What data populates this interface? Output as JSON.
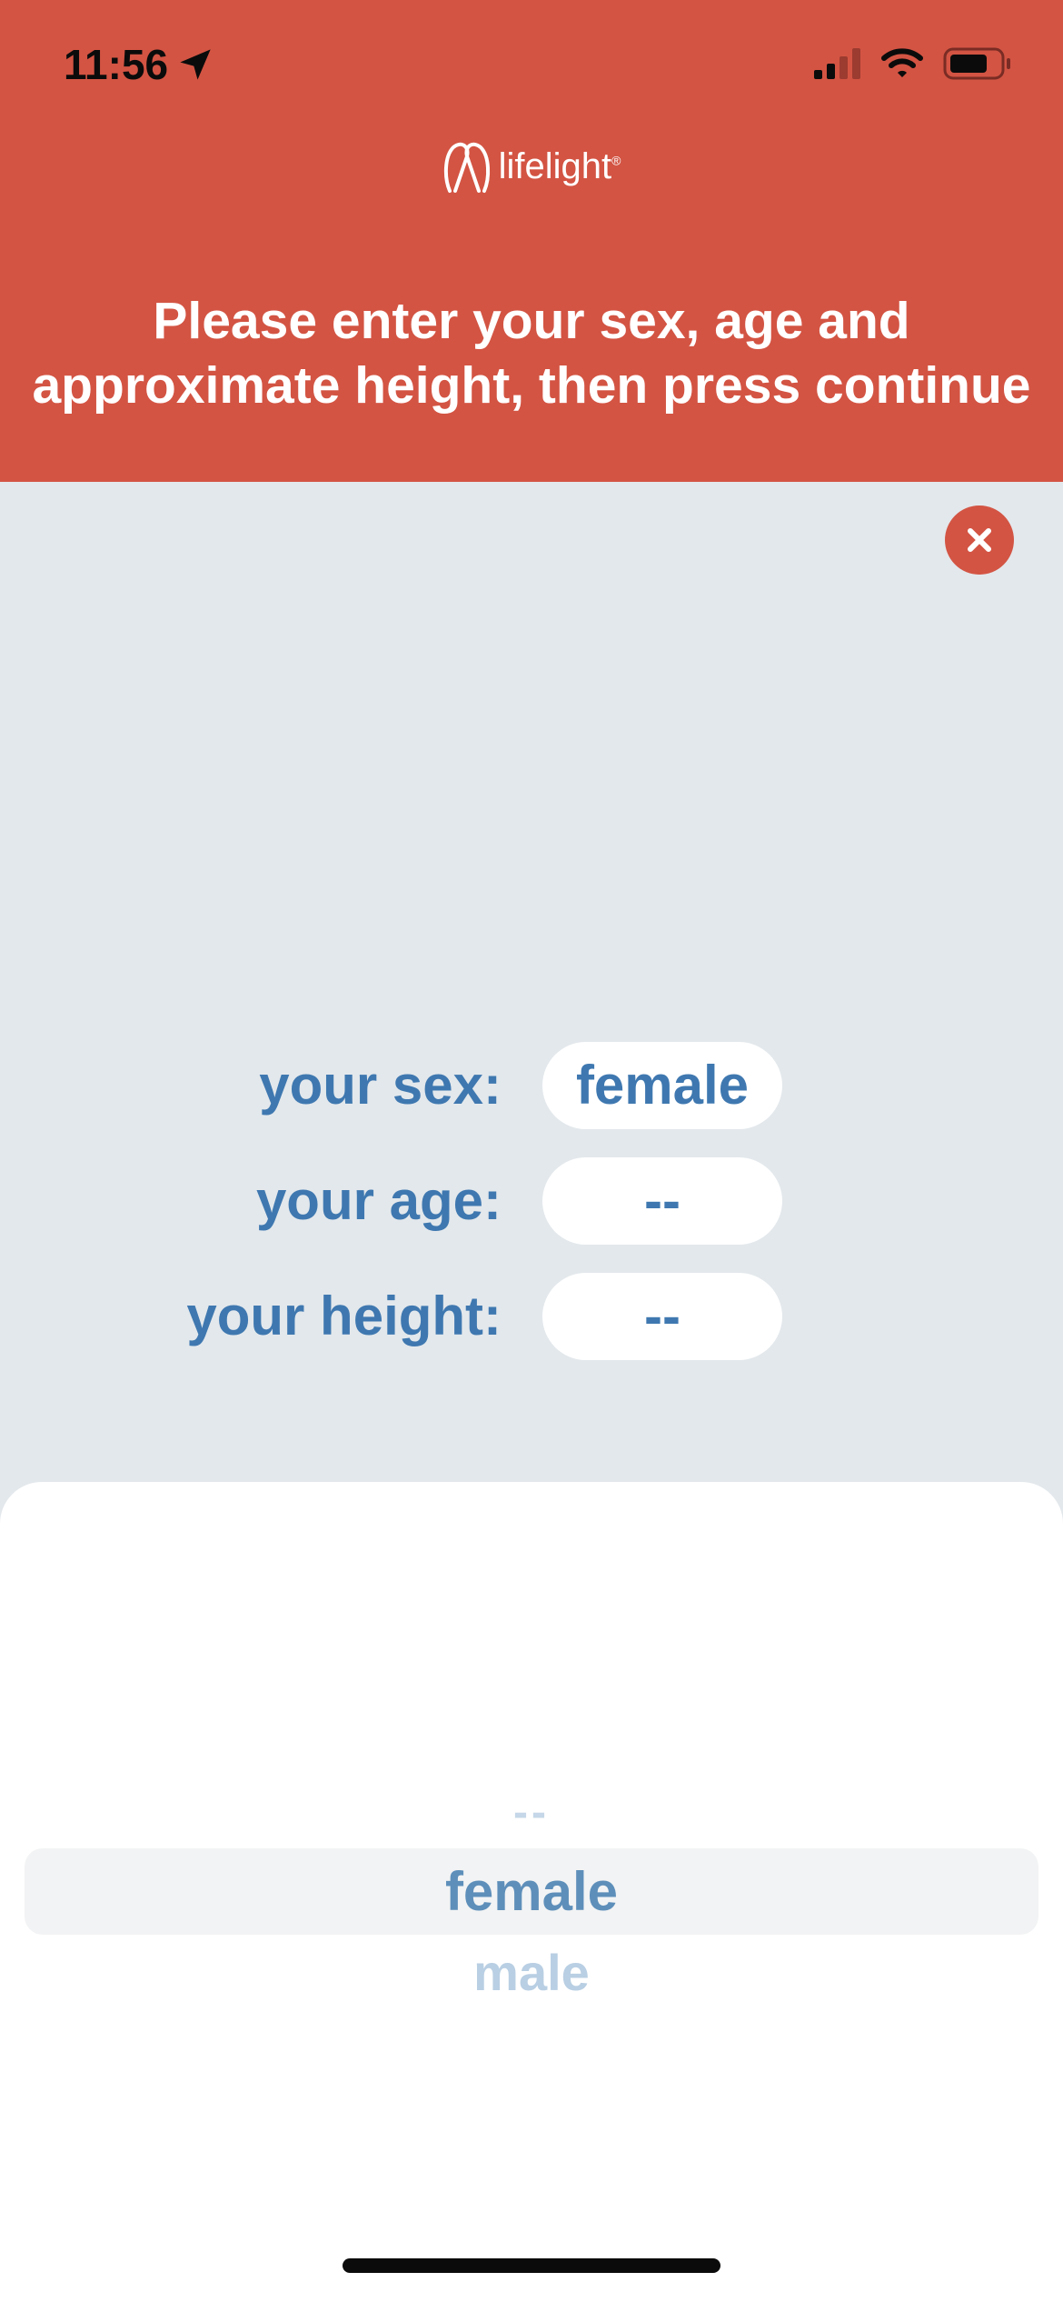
{
  "status_bar": {
    "time": "11:56"
  },
  "header": {
    "brand": "lifelight",
    "brand_mark": "®",
    "instructions_line1": "Please enter your sex, age and",
    "instructions_line2": "approximate height, then press continue"
  },
  "form": {
    "fields": [
      {
        "label": "your sex:",
        "value": "female"
      },
      {
        "label": "your age:",
        "value": "--"
      },
      {
        "label": "your height:",
        "value": "--"
      }
    ]
  },
  "picker": {
    "options": [
      "--",
      "female",
      "male"
    ],
    "selected": "female"
  },
  "icons": {
    "close": "close-icon",
    "location": "location-arrow-icon",
    "signal": "cellular-signal-icon",
    "wifi": "wifi-icon",
    "battery": "battery-icon",
    "logo": "lifelight-logo-icon"
  },
  "colors": {
    "header_bg": "#d35443",
    "page_bg": "#e3e8ec",
    "label_blue": "#3f78b0",
    "picker_selected": "#5e8fba",
    "picker_faded": "#b9cfe3"
  }
}
